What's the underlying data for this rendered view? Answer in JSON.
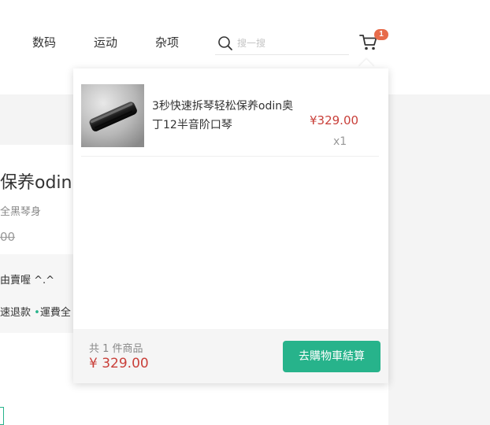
{
  "nav": {
    "items": [
      {
        "label": "数码"
      },
      {
        "label": "运动"
      },
      {
        "label": "杂项"
      }
    ]
  },
  "search": {
    "placeholder": "搜一搜",
    "icon": "search-icon"
  },
  "cart": {
    "icon": "cart-icon",
    "badge_count": "1"
  },
  "background_product": {
    "title_fragment": "保养odin",
    "subtitle_fragment": "全黑琴身",
    "old_price_fragment": "00",
    "info_line1_fragment": "由賣喔 ^.^",
    "info_line2_part1": "速退款",
    "info_line2_part2": "運費全"
  },
  "cart_popup": {
    "items": [
      {
        "name": "3秒快速拆琴轻松保养odin奥丁12半音阶口琴",
        "price": "¥329.00",
        "qty": "x1",
        "thumbnail": "harmonica-image"
      }
    ],
    "footer": {
      "count_text": "共 1 件商品",
      "total": "¥ 329.00",
      "checkout_label": "去購物車結算"
    }
  },
  "colors": {
    "accent": "#27b38b",
    "price_red": "#c9403a",
    "badge": "#e76b4a"
  }
}
